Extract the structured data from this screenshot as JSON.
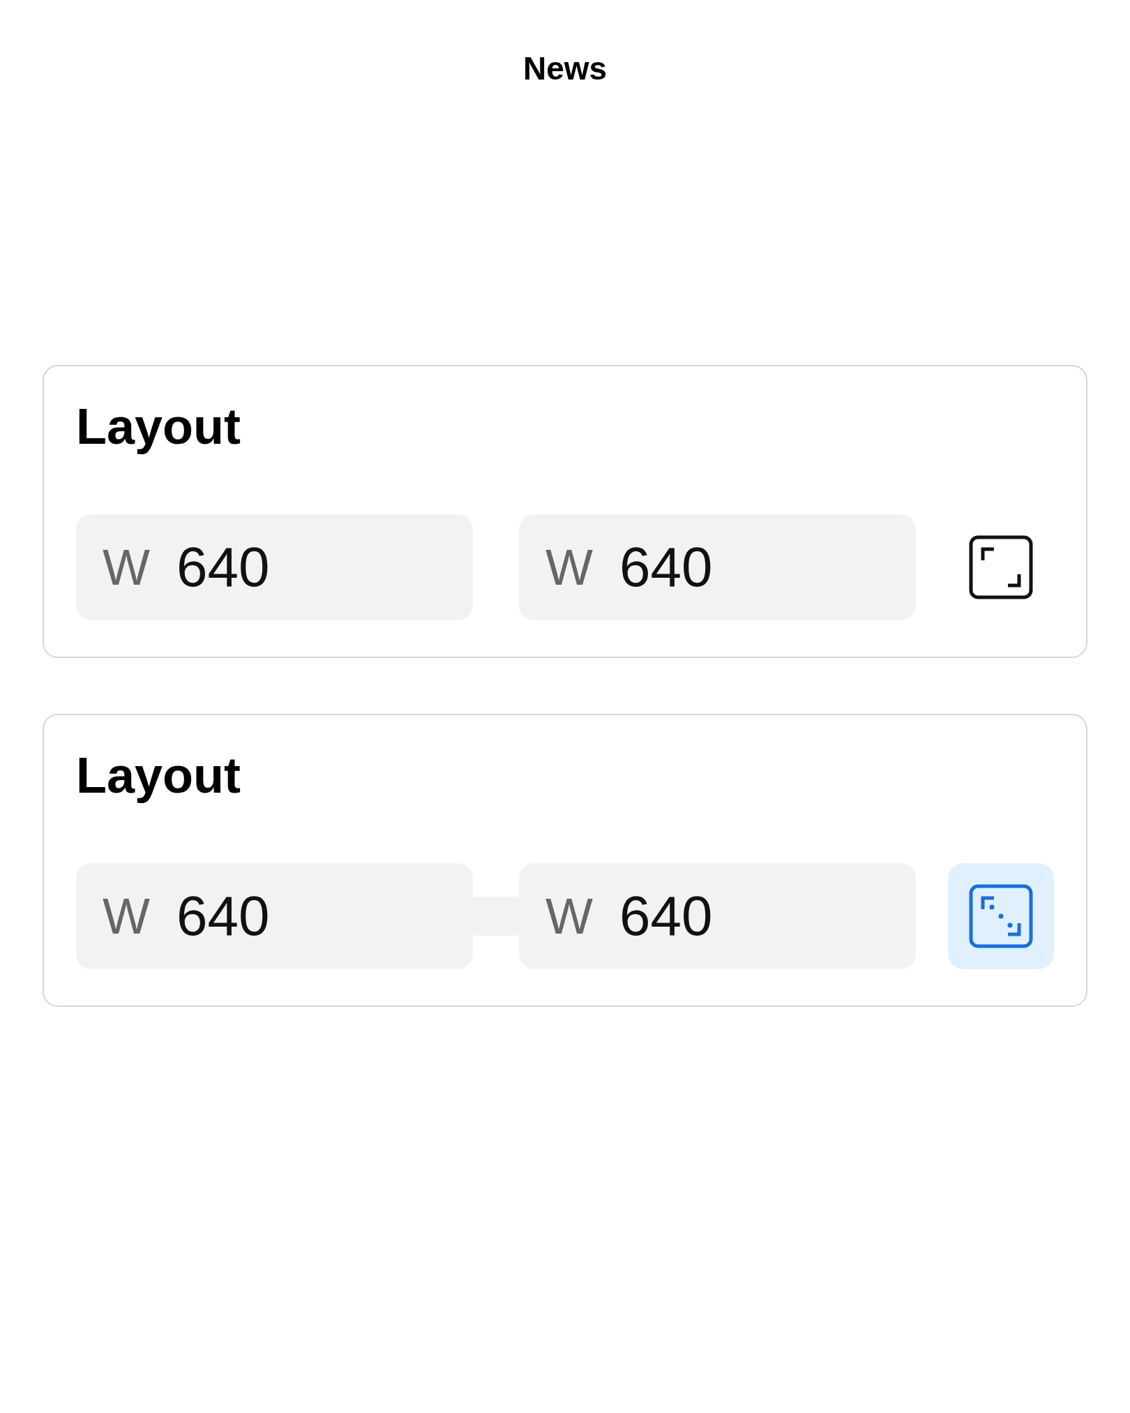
{
  "header": {
    "title": "News"
  },
  "cards": [
    {
      "title": "Layout",
      "linked": false,
      "fields": [
        {
          "label": "W",
          "value": "640"
        },
        {
          "label": "W",
          "value": "640"
        }
      ],
      "toggle": {
        "selected": false
      }
    },
    {
      "title": "Layout",
      "linked": true,
      "fields": [
        {
          "label": "W",
          "value": "640"
        },
        {
          "label": "W",
          "value": "640"
        }
      ],
      "toggle": {
        "selected": true
      }
    }
  ]
}
